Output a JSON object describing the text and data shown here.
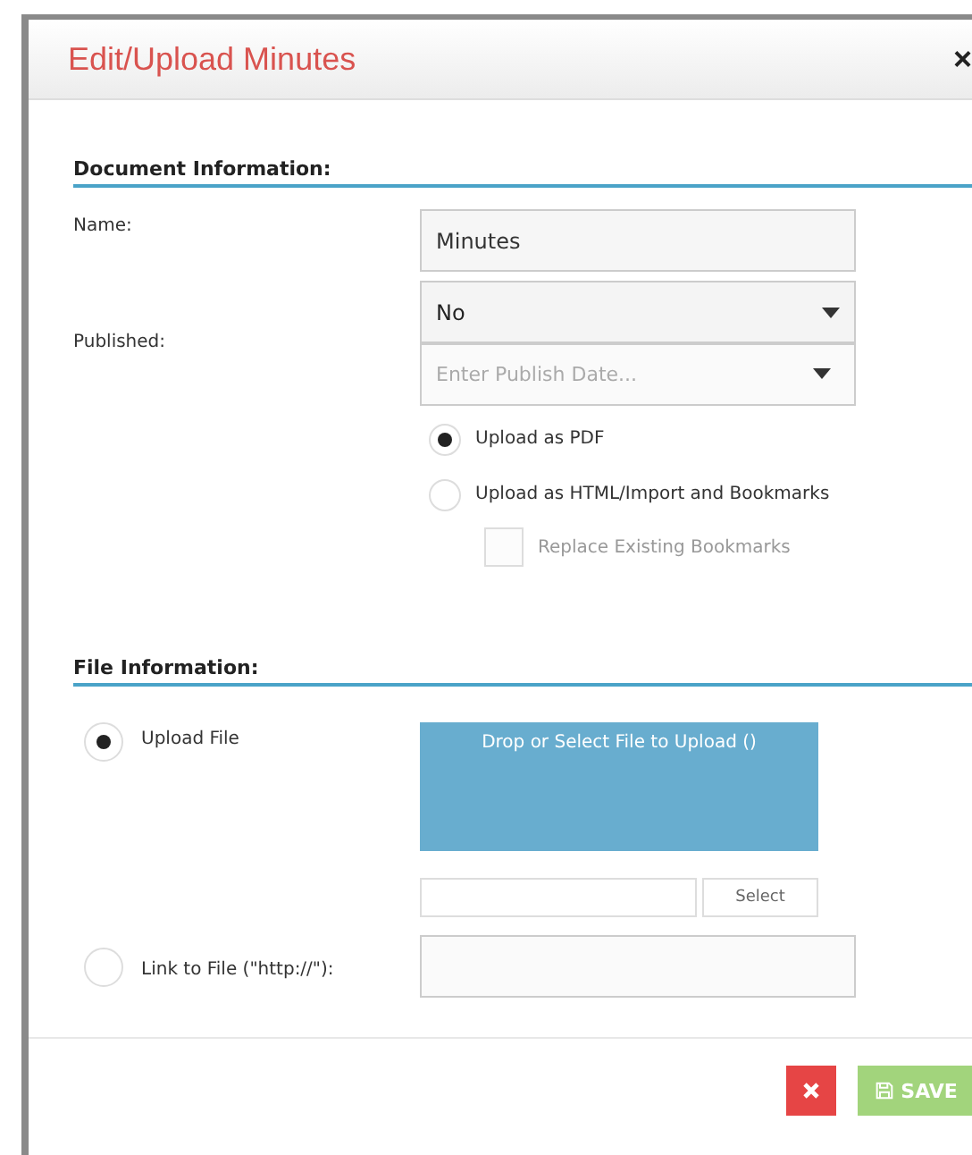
{
  "dialog": {
    "title": "Edit/Upload Minutes",
    "close": "×"
  },
  "document_information": {
    "heading": "Document Information:",
    "name": {
      "label": "Name:",
      "value": "Minutes"
    },
    "published": {
      "label": "Published:",
      "status": {
        "value": "No"
      },
      "date": {
        "placeholder": "Enter Publish Date..."
      }
    },
    "upload_options": [
      {
        "label": "Upload as PDF",
        "selected": true
      },
      {
        "label": "Upload as HTML/Import and Bookmarks",
        "selected": false
      }
    ],
    "replace_bookmarks": {
      "label": "Replace Existing Bookmarks",
      "checked": false,
      "disabled": true
    }
  },
  "file_information": {
    "heading": "File Information:",
    "sources": [
      {
        "kind": "upload",
        "label": "Upload File",
        "selected": true
      },
      {
        "kind": "link",
        "label": "Link to File (\"http://\"):",
        "selected": false
      }
    ],
    "drop_zone": {
      "text": "Drop or Select File to Upload ()"
    },
    "select_button": "Select"
  },
  "buttons": [
    {
      "kind": "cancel"
    },
    {
      "kind": "save",
      "label": "SAVE"
    }
  ]
}
